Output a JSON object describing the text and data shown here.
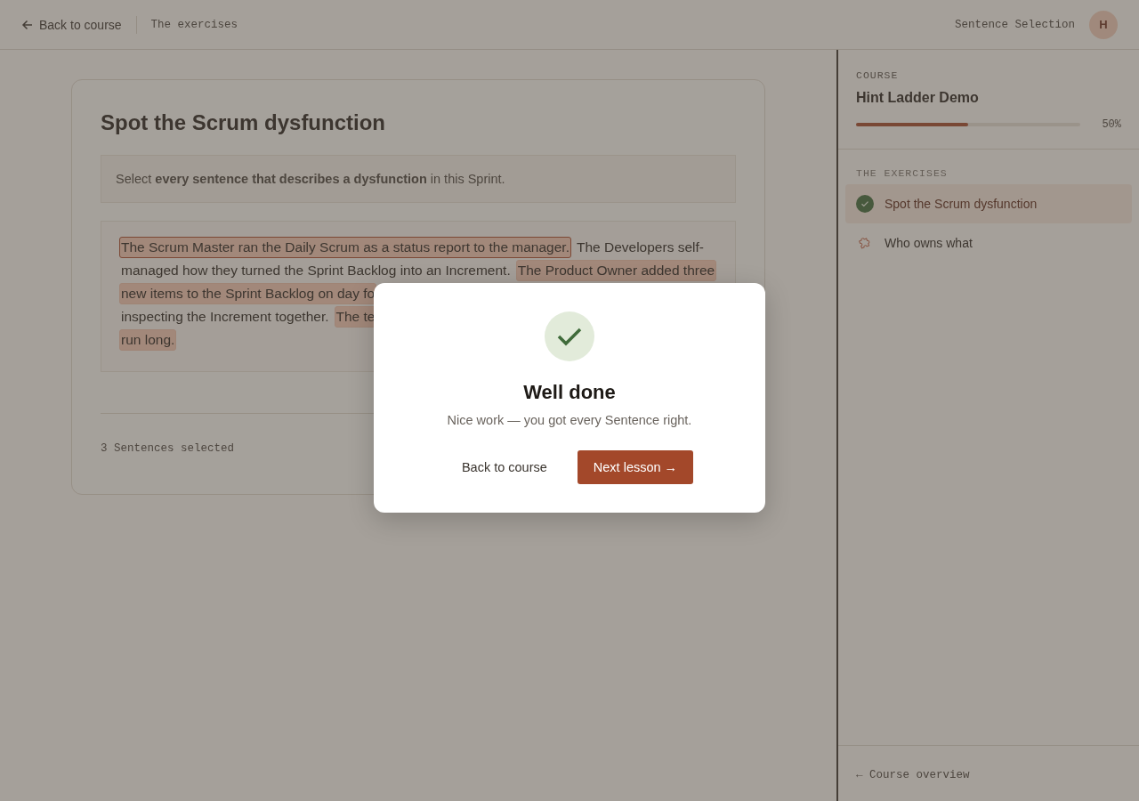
{
  "header": {
    "back_link": "Back to course",
    "breadcrumb": "The exercises",
    "mode": "Sentence Selection",
    "avatar": "H"
  },
  "exercise": {
    "title": "Spot the Scrum dysfunction",
    "instruction": "Select **every sentence that describes a dysfunction** in this Sprint.",
    "passage_lines": [
      [
        {
          "text": "The Scrum Master ran the Daily Scrum as a status report to the manager.",
          "selected": true,
          "focused": true
        },
        {
          "text": "The Developers self-",
          "selected": false,
          "focused": false
        }
      ],
      [
        {
          "text": "managed how they turned the Sprint Backlog into an Increment.",
          "selected": false,
          "focused": false
        },
        {
          "text": "The Product Owner added three",
          "selected": true,
          "focused": false
        }
      ],
      [
        {
          "text": "new items to the Sprint Backlog on day fo",
          "selected": true,
          "focused": false
        }
      ],
      [
        {
          "text": "inspecting the Increment together.",
          "selected": false,
          "focused": false
        },
        {
          "text": "The te",
          "selected": true,
          "focused": false
        }
      ],
      [
        {
          "text": "run long.",
          "selected": true,
          "focused": false
        }
      ]
    ],
    "status": "3 Sentences selected"
  },
  "sidebar": {
    "course_label": "COURSE",
    "course_title": "Hint Ladder Demo",
    "progress": {
      "level": 0.5,
      "reading": "50%"
    },
    "section_label": "THE EXERCISES",
    "items": [
      {
        "label": "Spot the Scrum dysfunction",
        "selected": true,
        "completed": true
      },
      {
        "label": "Who owns what",
        "selected": false,
        "completed": false
      }
    ],
    "footer_link": "← Course overview"
  },
  "dialog": {
    "title": "Well done",
    "message": "Nice work — you got every Sentence right.",
    "buttons": [
      {
        "label": "Back to course",
        "kind": "secondary"
      },
      {
        "label": "Next lesson →",
        "kind": "primary"
      }
    ]
  }
}
